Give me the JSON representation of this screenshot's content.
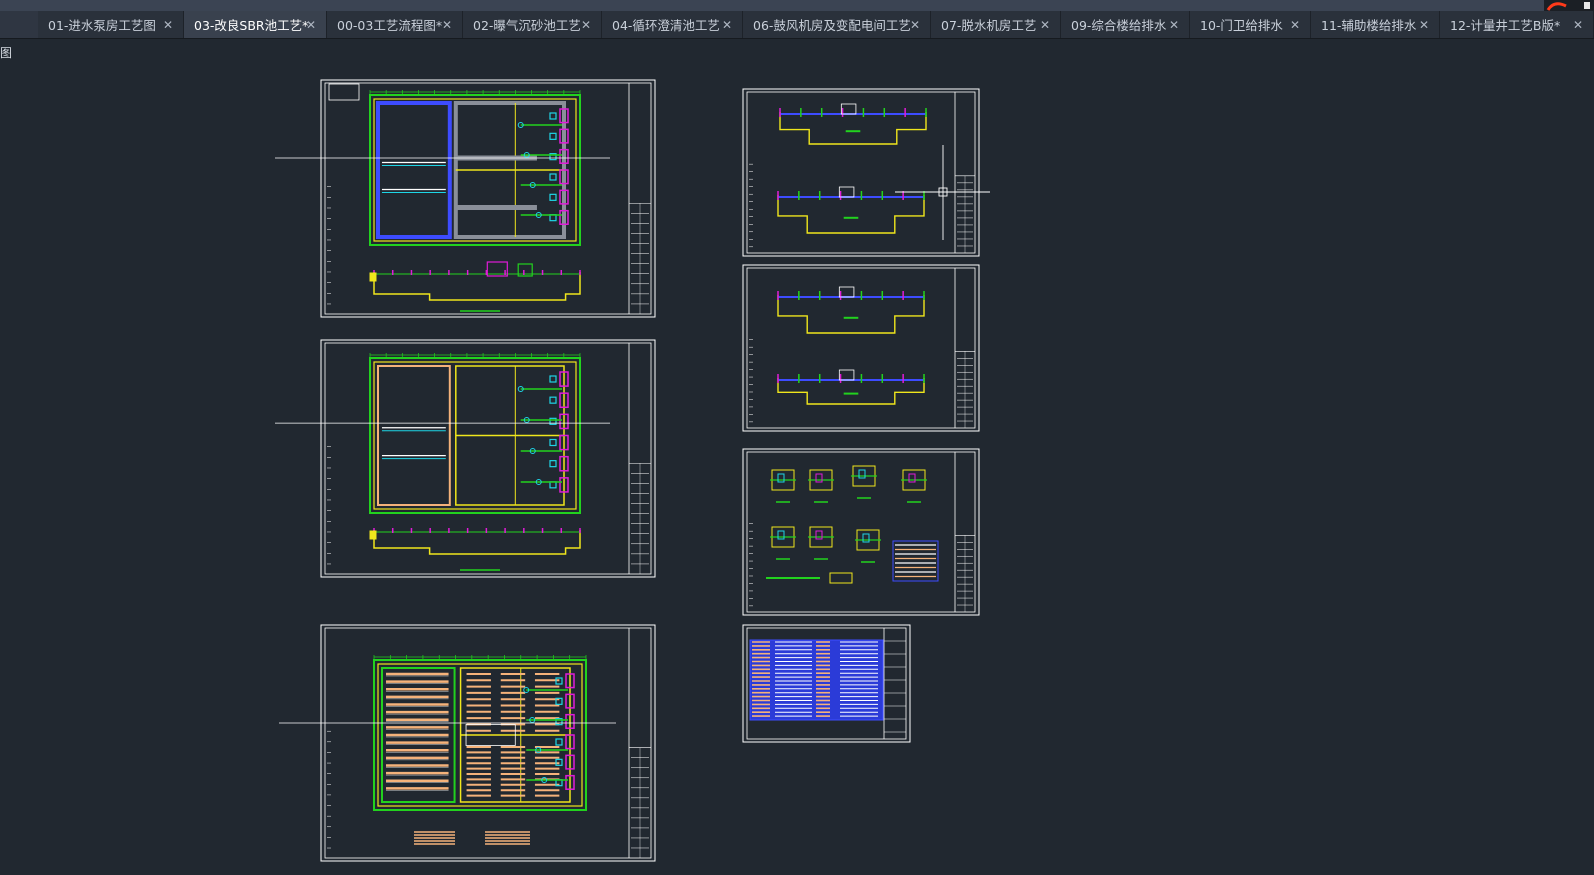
{
  "tabs": [
    {
      "label": "01-进水泵房工艺图",
      "active": false
    },
    {
      "label": "03-改良SBR池工艺*",
      "active": true
    },
    {
      "label": "00-03工艺流程图*",
      "active": false
    },
    {
      "label": "02-曝气沉砂池工艺",
      "active": false
    },
    {
      "label": "04-循环澄清池工艺",
      "active": false
    },
    {
      "label": "06-鼓风机房及变配电间工艺",
      "active": false
    },
    {
      "label": "07-脱水机房工艺",
      "active": false
    },
    {
      "label": "09-综合楼给排水",
      "active": false
    },
    {
      "label": "10-门卫给排水",
      "active": false
    },
    {
      "label": "11-辅助楼给排水",
      "active": false
    },
    {
      "label": "12-计量井工艺B版*",
      "active": false
    }
  ],
  "close_glyph": "✕",
  "viewport_label": "图",
  "colors": {
    "background": "#212830",
    "sheet_border": "#ffffff",
    "green": "#22d21e",
    "yellow": "#f0e61c",
    "magenta": "#e01cd8",
    "blue": "#3d4cff",
    "cyan": "#1ed6e6",
    "orange": "#f5b27a",
    "gray": "#8a8f99",
    "red": "#ff2a1a"
  },
  "icons": {
    "close": "close-icon",
    "crosshair": "crosshair-icon",
    "app_logo": "app-logo-icon"
  }
}
